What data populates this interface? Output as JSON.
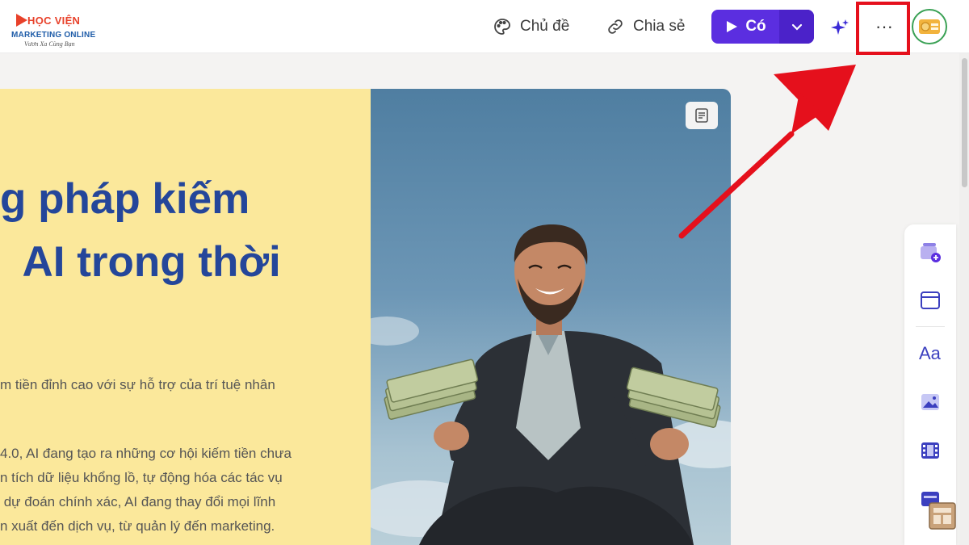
{
  "logo": {
    "line1": "HỌC VIỆN",
    "line2": "MARKETING ONLINE",
    "line3": "Vươn Xa Cùng Bạn"
  },
  "toolbar": {
    "theme_label": "Chủ đề",
    "share_label": "Chia sẻ",
    "present_label": "Có",
    "more_label": "···"
  },
  "slide": {
    "title": "g pháp kiếm\n  AI trong thời",
    "lead": "m tiền đỉnh cao với sự hỗ trợ của trí tuệ nhân",
    "body": "4.0, AI đang tạo ra những cơ hội kiếm tiền chưa\nn tích dữ liệu khổng lồ, tự động hóa các tác vụ\n dự đoán chính xác, AI đang thay đổi mọi lĩnh\nn xuất đến dịch vụ, từ quản lý đến marketing."
  },
  "rail": {
    "items": [
      "add-card-icon",
      "layout-icon",
      "text-icon",
      "image-icon",
      "video-icon",
      "embed-icon"
    ],
    "text_glyph": "Aa"
  },
  "colors": {
    "accent": "#5b2ee0",
    "highlight": "#e5101c",
    "slide_bg": "#fbe89b",
    "title": "#24469a"
  }
}
